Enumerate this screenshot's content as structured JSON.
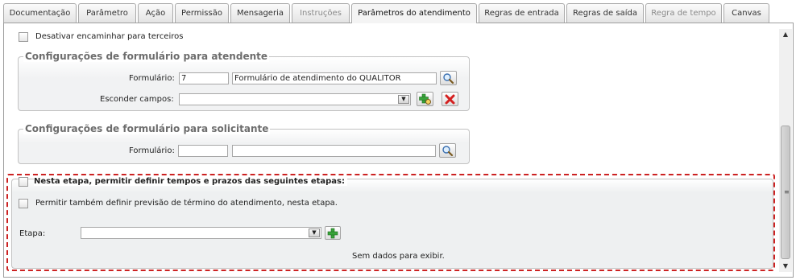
{
  "tabs": [
    {
      "label": "Documentação",
      "state": "normal"
    },
    {
      "label": "Parâmetro",
      "state": "normal"
    },
    {
      "label": "Ação",
      "state": "normal"
    },
    {
      "label": "Permissão",
      "state": "normal"
    },
    {
      "label": "Mensageria",
      "state": "normal"
    },
    {
      "label": "Instruções",
      "state": "disabled"
    },
    {
      "label": "Parâmetros do atendimento",
      "state": "active"
    },
    {
      "label": "Regras de entrada",
      "state": "normal"
    },
    {
      "label": "Regras de saída",
      "state": "normal"
    },
    {
      "label": "Regra de tempo",
      "state": "disabled"
    },
    {
      "label": "Canvas",
      "state": "normal"
    }
  ],
  "top_option": {
    "label": "Desativar encaminhar para terceiros",
    "checked": false
  },
  "attendant_form": {
    "legend": "Configurações de formulário para atendente",
    "form_label": "Formulário:",
    "form_code": "7",
    "form_name": "Formulário de atendimento do QUALITOR",
    "hide_fields_label": "Esconder campos:",
    "hide_fields_value": ""
  },
  "requester_form": {
    "legend": "Configurações de formulário para solicitante",
    "form_label": "Formulário:",
    "form_code": "",
    "form_name": ""
  },
  "stage_times": {
    "legend": "Nesta etapa, permitir definir tempos e prazos das seguintes etapas:",
    "legend_checked": false,
    "forecast_label": "Permitir também definir previsão de término do atendimento, nesta etapa.",
    "forecast_checked": false,
    "stage_label": "Etapa:",
    "stage_value": "",
    "empty_text": "Sem dados para exibir."
  },
  "icons": {
    "search": "magnifier-icon",
    "add_field": "green-plus-icon",
    "remove": "red-x-icon",
    "add": "green-plus-icon"
  },
  "colors": {
    "highlight_border": "#cc2222",
    "legend_text": "#6d6d6d"
  }
}
